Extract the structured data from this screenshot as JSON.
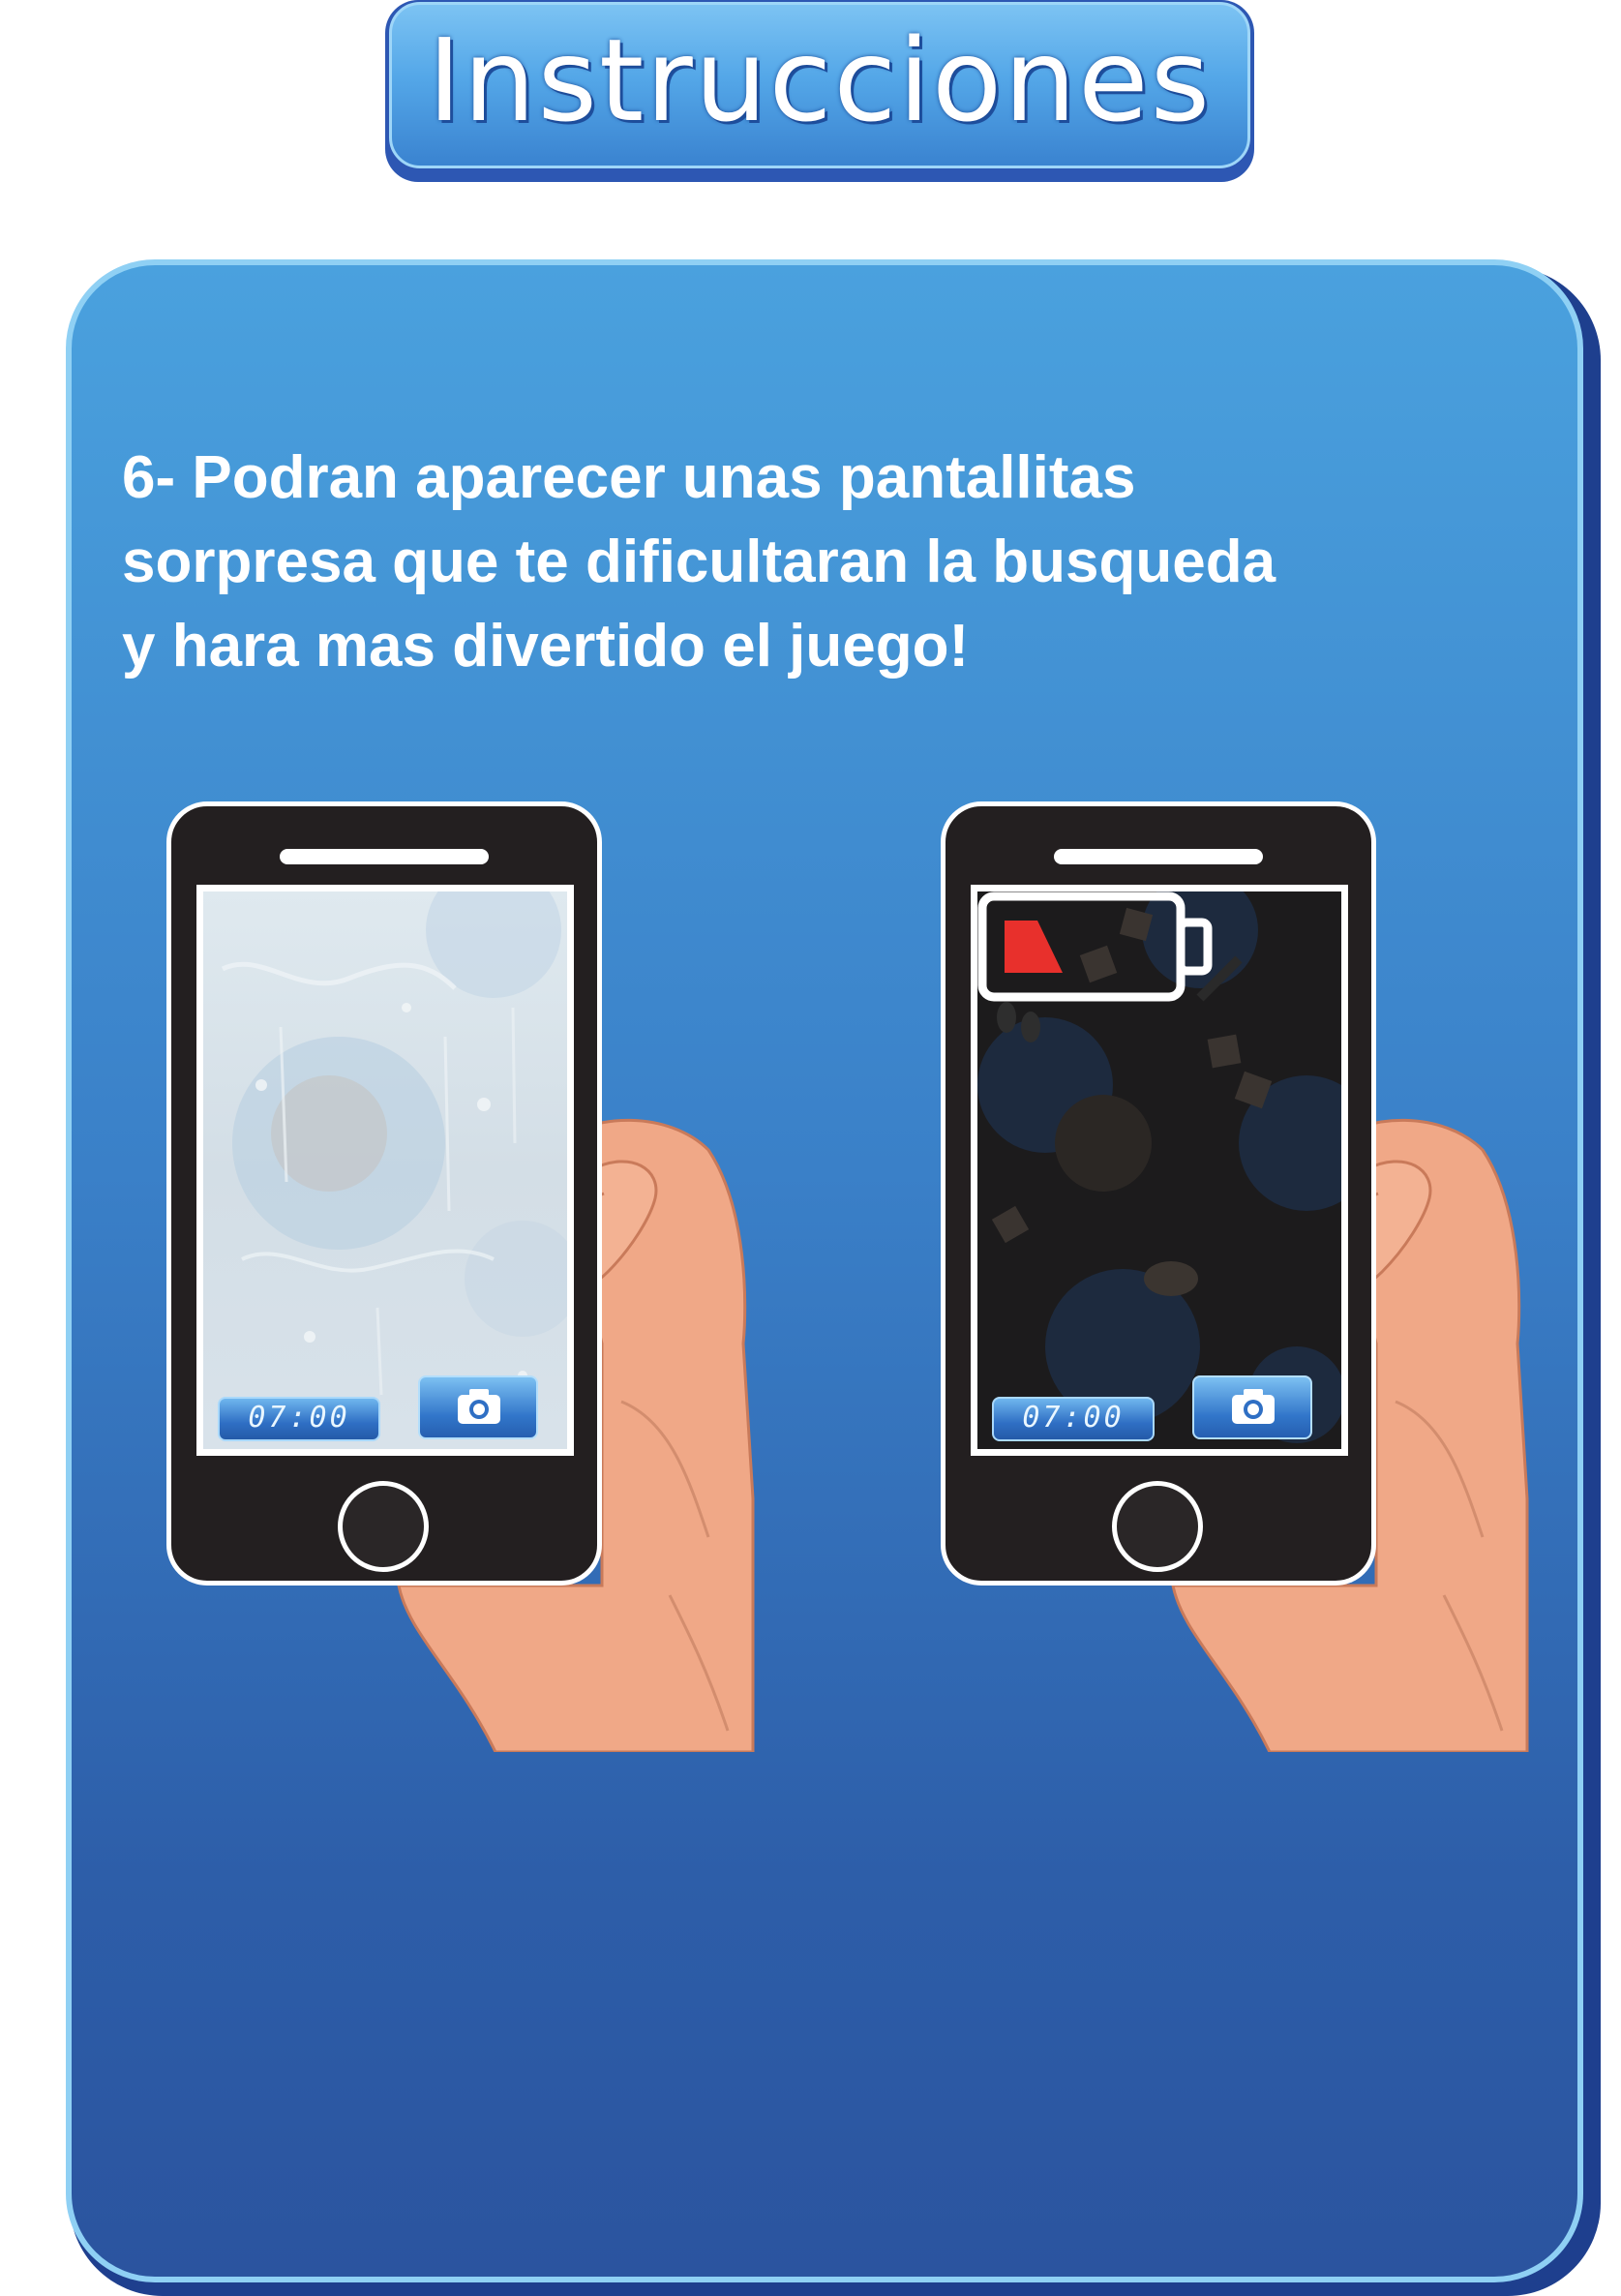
{
  "header": {
    "title": "Instrucciones"
  },
  "instruction": {
    "text": "6- Podran aparecer unas pantallitas\nsorpresa que te  dificultaran la busqueda\ny hara mas divertido el juego!"
  },
  "phones": [
    {
      "effect": "fogged-screen",
      "timer": "07:00",
      "camera_icon": "camera-icon"
    },
    {
      "effect": "low-battery",
      "timer": "07:00",
      "camera_icon": "camera-icon",
      "overlay_icon": "low-battery-icon"
    }
  ],
  "colors": {
    "card_top": "#4aa1de",
    "card_bottom": "#2b549f",
    "card_border": "#8fd0f4",
    "phone_body": "#231f20",
    "skin": "#f0a887",
    "battery_red": "#e8302c"
  }
}
